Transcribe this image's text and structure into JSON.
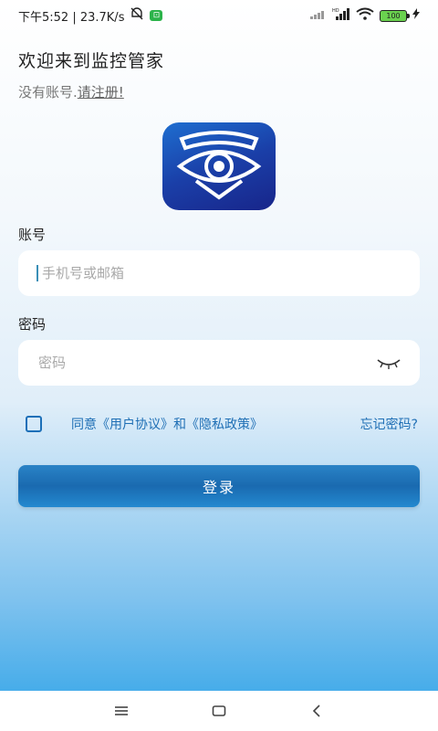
{
  "status_bar": {
    "time_speed": "下午5:52 | 23.7K/s",
    "battery": "100"
  },
  "header": {
    "welcome": "欢迎来到监控管家",
    "no_account": "没有账号.",
    "register_link": "请注册!"
  },
  "logo": {
    "icon": "eye-shield-icon"
  },
  "account": {
    "label": "账号",
    "placeholder": "手机号或邮箱",
    "value": ""
  },
  "password": {
    "label": "密码",
    "placeholder": "密码",
    "value": "",
    "toggle_icon": "eye-closed-icon"
  },
  "agreement": {
    "checked": false,
    "text": "同意《用户协议》和《隐私政策》",
    "forgot": "忘记密码?"
  },
  "login_button": "登录",
  "colors": {
    "accent": "#1f6fb5",
    "button": "#1a6ab0",
    "background_bottom": "#2ea3e8"
  },
  "nav": {
    "menu_icon": "menu-icon",
    "home_icon": "home-icon",
    "back_icon": "back-icon"
  }
}
